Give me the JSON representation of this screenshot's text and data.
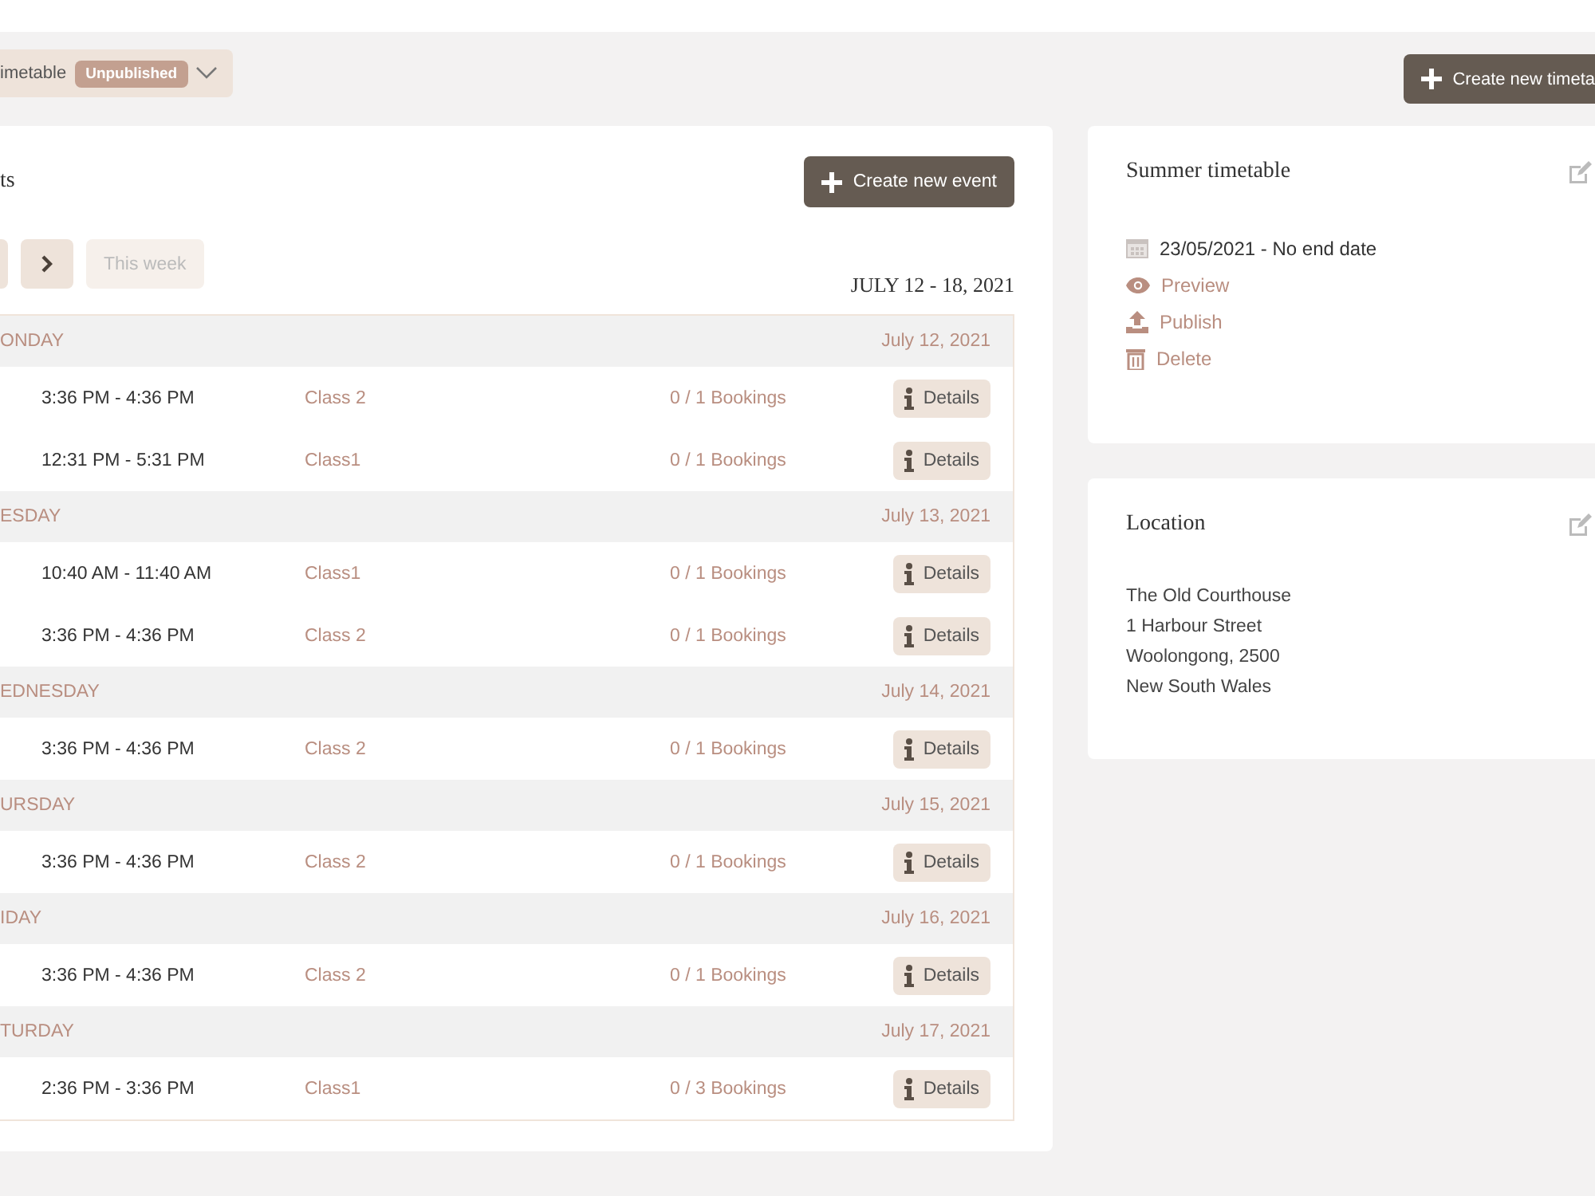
{
  "toolbar": {
    "timetable_select": {
      "label": "imetable",
      "badge": "Unpublished"
    },
    "create_timetable_button": "Create new timeta"
  },
  "events_panel": {
    "title": "ts",
    "create_event_button": "Create new event",
    "this_week_button": {
      "label": "This week",
      "disabled": true
    },
    "week_range": "JULY 12 - 18, 2021",
    "days": [
      {
        "day": "ONDAY",
        "date": "July 12, 2021",
        "events": [
          {
            "time": "3:36 PM - 4:36 PM",
            "class": "Class 2",
            "bookings": "0 / 1 Bookings",
            "details": "Details"
          },
          {
            "time": "12:31 PM - 5:31 PM",
            "class": "Class1",
            "bookings": "0 / 1 Bookings",
            "details": "Details"
          }
        ]
      },
      {
        "day": "ESDAY",
        "date": "July 13, 2021",
        "events": [
          {
            "time": "10:40 AM - 11:40 AM",
            "class": "Class1",
            "bookings": "0 / 1 Bookings",
            "details": "Details"
          },
          {
            "time": "3:36 PM - 4:36 PM",
            "class": "Class 2",
            "bookings": "0 / 1 Bookings",
            "details": "Details"
          }
        ]
      },
      {
        "day": "EDNESDAY",
        "date": "July 14, 2021",
        "events": [
          {
            "time": "3:36 PM - 4:36 PM",
            "class": "Class 2",
            "bookings": "0 / 1 Bookings",
            "details": "Details"
          }
        ]
      },
      {
        "day": "URSDAY",
        "date": "July 15, 2021",
        "events": [
          {
            "time": "3:36 PM - 4:36 PM",
            "class": "Class 2",
            "bookings": "0 / 1 Bookings",
            "details": "Details"
          }
        ]
      },
      {
        "day": "IDAY",
        "date": "July 16, 2021",
        "events": [
          {
            "time": "3:36 PM - 4:36 PM",
            "class": "Class 2",
            "bookings": "0 / 1 Bookings",
            "details": "Details"
          }
        ]
      },
      {
        "day": "TURDAY",
        "date": "July 17, 2021",
        "events": [
          {
            "time": "2:36 PM - 3:36 PM",
            "class": "Class1",
            "bookings": "0 / 3 Bookings",
            "details": "Details"
          }
        ]
      }
    ]
  },
  "timetable_card": {
    "title": "Summer timetable",
    "dates": "23/05/2021 - No end date",
    "actions": [
      {
        "kind": "preview",
        "label": "Preview"
      },
      {
        "kind": "publish",
        "label": "Publish"
      },
      {
        "kind": "delete",
        "label": "Delete"
      }
    ]
  },
  "location_card": {
    "title": "Location",
    "lines": [
      "The Old Courthouse",
      "1 Harbour Street",
      "Woolongong, 2500",
      "New South Wales"
    ]
  }
}
